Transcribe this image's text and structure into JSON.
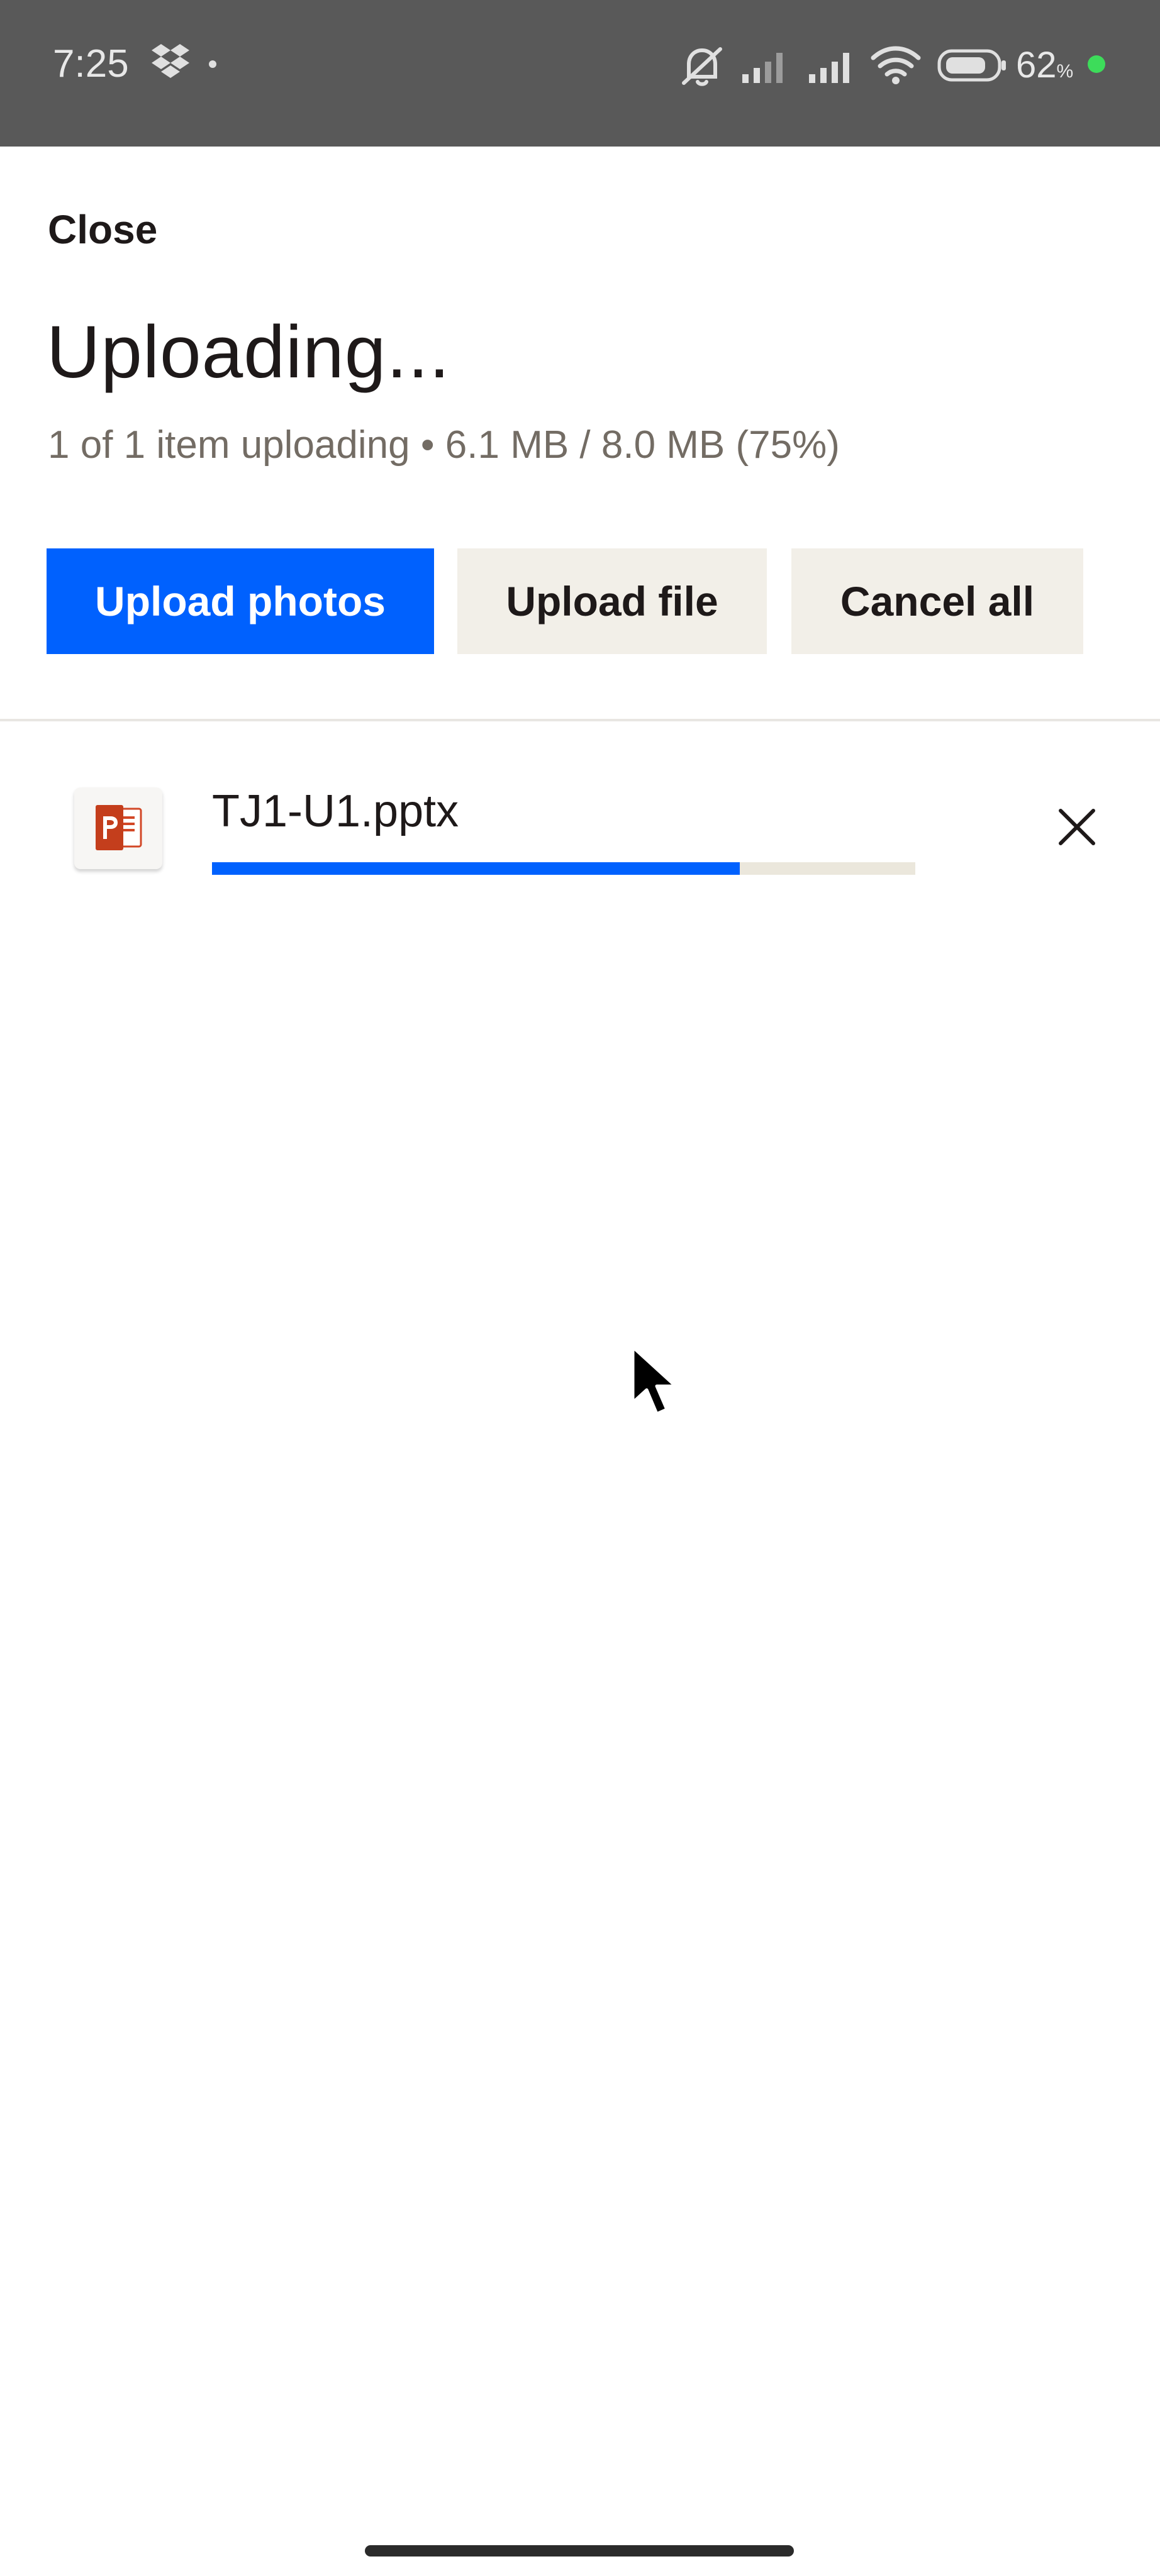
{
  "status_bar": {
    "time": "7:25",
    "battery_level": "62",
    "battery_unit": "%",
    "icons": [
      "dropbox-icon",
      "notification-dot",
      "silent-bell-icon",
      "signal-icon",
      "signal-icon",
      "wifi-icon",
      "battery-icon",
      "charging-dot"
    ],
    "charging_dot_color": "#3ddc5a"
  },
  "header": {
    "close_label": "Close",
    "title": "Uploading...",
    "summary": "1 of 1 item uploading • 6.1 MB / 8.0 MB (75%)"
  },
  "actions": {
    "upload_photos_label": "Upload photos",
    "upload_file_label": "Upload file",
    "cancel_all_label": "Cancel all"
  },
  "uploads": [
    {
      "file_name": "TJ1-U1.pptx",
      "file_icon": "powerpoint-file-icon",
      "progress_percent": 75,
      "cancel_icon": "close-icon"
    }
  ],
  "colors": {
    "accent": "#0061fe",
    "secondary_button_bg": "#f2efe8",
    "progress_track": "#ebe7dc",
    "text_primary": "#1e1919",
    "text_secondary": "#736c64",
    "status_bar_bg": "#595959"
  }
}
